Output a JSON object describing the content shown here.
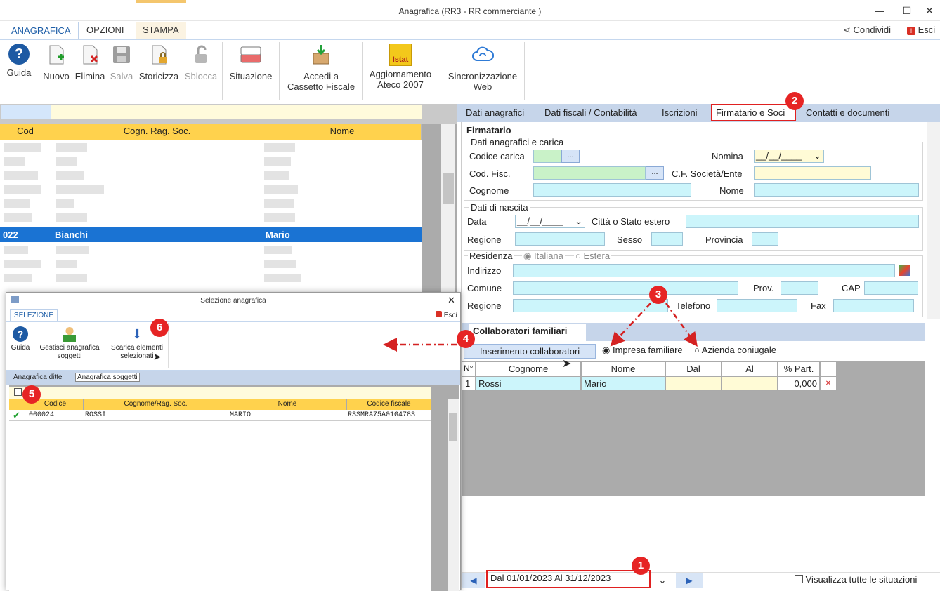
{
  "window": {
    "title": "Anagrafica (RR3 - RR  commerciante )",
    "minimize": "—",
    "maximize": "☐",
    "close": "✕"
  },
  "ribbon": {
    "tabs": [
      "ANAGRAFICA",
      "OPZIONI",
      "STAMPA"
    ],
    "share": "Condividi",
    "exit": "Esci",
    "buttons": {
      "guida": "Guida",
      "nuovo": "Nuovo",
      "elimina": "Elimina",
      "salva": "Salva",
      "storicizza": "Storicizza",
      "sblocca": "Sblocca",
      "situazione": "Situazione",
      "cassetto1": "Accedi a",
      "cassetto2": "Cassetto Fiscale",
      "ateco1": "Aggiornamento",
      "ateco2": "Ateco 2007",
      "istat": "Istat",
      "sync1": "Sincronizzazione",
      "sync2": "Web"
    }
  },
  "grid": {
    "headers": [
      "Cod",
      "Cogn. Rag. Soc.",
      "Nome"
    ],
    "selected": {
      "cod": "022",
      "cognome": "Bianchi",
      "nome": "Mario"
    }
  },
  "right_tabs": [
    "Dati anagrafici",
    "Dati fiscali / Contabilità",
    "Iscrizioni",
    "Firmatario e Soci",
    "Contatti e documenti"
  ],
  "firmatario": {
    "title": "Firmatario",
    "grp1": "Dati anagrafici e carica",
    "codice_carica": "Codice carica",
    "nomina": "Nomina",
    "nomina_value": "__/__/____",
    "cod_fisc": "Cod. Fisc.",
    "cf_soc": "C.F. Società/Ente",
    "cognome": "Cognome",
    "nome": "Nome",
    "grp2": "Dati di nascita",
    "data": "Data",
    "data_value": "__/__/____",
    "citta": "Città o Stato estero",
    "regione": "Regione",
    "sesso": "Sesso",
    "provincia": "Provincia",
    "residenza": "Residenza",
    "italiana": "Italiana",
    "estera": "Estera",
    "indirizzo": "Indirizzo",
    "comune": "Comune",
    "prov": "Prov.",
    "cap": "CAP",
    "regione2": "Regione",
    "telefono": "Telefono",
    "fax": "Fax"
  },
  "collab": {
    "tab": "Collaboratori familiari",
    "insert": "Inserimento collaboratori",
    "impresa": "Impresa familiare",
    "azienda": "Azienda coniugale",
    "headers": [
      "N°",
      "Cognome",
      "Nome",
      "Dal",
      "Al",
      "% Part."
    ],
    "row": {
      "n": "1",
      "cognome": "Rossi",
      "nome": "Mario",
      "dal": "",
      "al": "",
      "part": "0,000"
    }
  },
  "footer": {
    "period": "Dal 01/01/2023 Al 31/12/2023",
    "visualizza": "Visualizza tutte le situazioni"
  },
  "badges": [
    "1",
    "2",
    "3",
    "4",
    "5",
    "6"
  ],
  "dialog": {
    "title": "Selezione anagrafica",
    "tab": "SELEZIONE",
    "exit": "Esci",
    "guida": "Guida",
    "gestisci1": "Gestisci anagrafica",
    "gestisci2": "soggetti",
    "scarica1": "Scarica elementi",
    "scarica2": "selezionati",
    "subtab1": "Anagrafica ditte",
    "subtab2": "Anagrafica soggetti",
    "headers": [
      "Codice",
      "Cognome/Rag. Soc.",
      "Nome",
      "Codice fiscale"
    ],
    "row": {
      "codice": "000024",
      "cognome": "ROSSI",
      "nome": "MARIO",
      "cf": "RSSMRA75A01G478S"
    }
  },
  "colors": {
    "accent": "#1f5fa8",
    "header_yellow": "#ffd24d",
    "selection_blue": "#1a73d3",
    "badge_red": "#e62424",
    "field_cyan": "#ccf5fb",
    "field_green": "#c9f2c8"
  }
}
